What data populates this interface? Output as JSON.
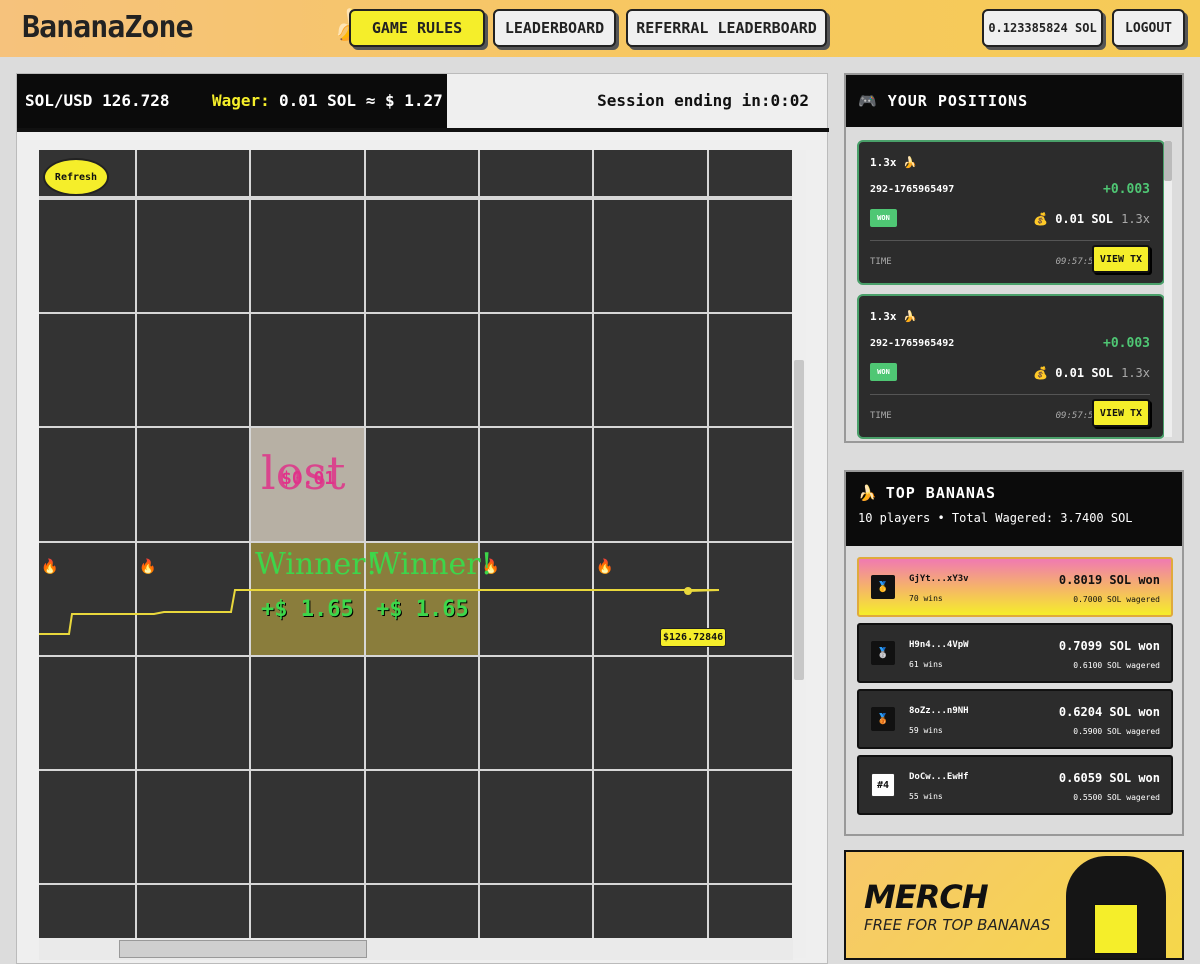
{
  "header": {
    "logo": "BananaZone",
    "nav": {
      "game_rules": "GAME RULES",
      "leaderboard": "LEADERBOARD",
      "referral": "REFERRAL LEADERBOARD"
    },
    "balance": "0.123385824 SOL",
    "logout": "LOGOUT"
  },
  "game": {
    "price": "SOL/USD 126.728",
    "wager_label": "Wager:",
    "wager_value": "0.01 SOL ≈ $ 1.27",
    "session": "Session ending in:0:02",
    "refresh": "Refresh",
    "lost_label": "lost",
    "lost_amount": "$0.01",
    "winner_label": "Winner!",
    "win_amount": "+$ 1.65",
    "price_tag": "$126.72846",
    "colors": {
      "accent": "#f5ee2a",
      "win": "#3dd64a",
      "lose": "#e0338a",
      "line": "#e9d83c"
    }
  },
  "positions": {
    "title": "YOUR POSITIONS",
    "items": [
      {
        "mult": "1.3x 🍌",
        "id": "292-1765965497",
        "gain": "+0.003",
        "status": "WON",
        "amount": "0.01 SOL",
        "amount_mult": "1.3x",
        "time_label": "TIME",
        "time": "09:57:58",
        "button": "VIEW TX"
      },
      {
        "mult": "1.3x 🍌",
        "id": "292-1765965492",
        "gain": "+0.003",
        "status": "WON",
        "amount": "0.01 SOL",
        "amount_mult": "1.3x",
        "time_label": "TIME",
        "time": "09:57:58",
        "button": "VIEW TX"
      }
    ]
  },
  "top": {
    "title": "TOP BANANAS",
    "subtitle": "10 players • Total Wagered: 3.7400 SOL",
    "rows": [
      {
        "rank": "🥇",
        "addr": "GjYt...xY3v",
        "wins": "70 wins",
        "won": "0.8019 SOL won",
        "wagered": "0.7000 SOL wagered"
      },
      {
        "rank": "🥈",
        "addr": "H9n4...4VpW",
        "wins": "61 wins",
        "won": "0.7099 SOL won",
        "wagered": "0.6100 SOL wagered"
      },
      {
        "rank": "🥉",
        "addr": "8oZz...n9NH",
        "wins": "59 wins",
        "won": "0.6204 SOL won",
        "wagered": "0.5900 SOL wagered"
      },
      {
        "rank": "#4",
        "addr": "DoCw...EwHf",
        "wins": "55 wins",
        "won": "0.6059 SOL won",
        "wagered": "0.5500 SOL wagered"
      }
    ]
  },
  "merch": {
    "title": "MERCH",
    "subtitle": "FREE FOR TOP BANANAS"
  }
}
